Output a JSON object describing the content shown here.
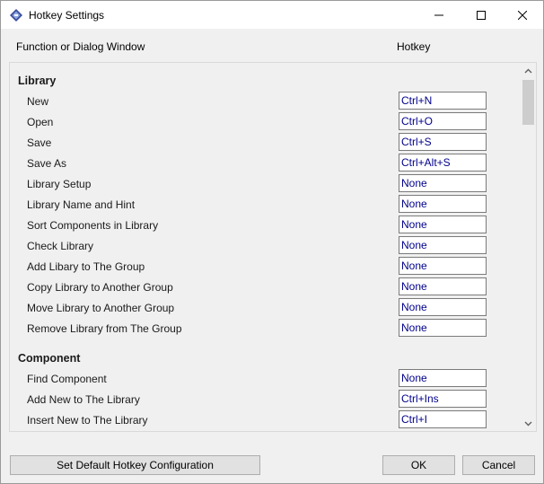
{
  "window": {
    "title": "Hotkey Settings",
    "app_icon": "app-diamond-icon",
    "minimize_icon": "minimize-icon",
    "maximize_icon": "maximize-icon",
    "close_icon": "close-icon"
  },
  "header": {
    "function_label": "Function or Dialog Window",
    "hotkey_label": "Hotkey"
  },
  "colors": {
    "hotkey_text": "#00008b",
    "window_bg": "#f0f0f0",
    "titlebar_bg": "#ffffff"
  },
  "groups": [
    {
      "title": "Library",
      "items": [
        {
          "label": "New",
          "hotkey": "Ctrl+N"
        },
        {
          "label": "Open",
          "hotkey": "Ctrl+O"
        },
        {
          "label": "Save",
          "hotkey": "Ctrl+S"
        },
        {
          "label": "Save As",
          "hotkey": "Ctrl+Alt+S"
        },
        {
          "label": "Library Setup",
          "hotkey": "None"
        },
        {
          "label": "Library Name and Hint",
          "hotkey": "None"
        },
        {
          "label": "Sort Components in Library",
          "hotkey": "None"
        },
        {
          "label": "Check Library",
          "hotkey": "None"
        },
        {
          "label": "Add Libary to The Group",
          "hotkey": "None"
        },
        {
          "label": "Copy Library to Another Group",
          "hotkey": "None"
        },
        {
          "label": "Move Library to Another Group",
          "hotkey": "None"
        },
        {
          "label": "Remove Library from The Group",
          "hotkey": "None"
        }
      ]
    },
    {
      "title": "Component",
      "items": [
        {
          "label": "Find Component",
          "hotkey": "None"
        },
        {
          "label": "Add New to The Library",
          "hotkey": "Ctrl+Ins"
        },
        {
          "label": "Insert New to The Library",
          "hotkey": "Ctrl+I"
        }
      ]
    }
  ],
  "buttons": {
    "default_config": "Set Default Hotkey Configuration",
    "ok": "OK",
    "cancel": "Cancel"
  },
  "scrollbar": {
    "up_icon": "scroll-up-arrow-icon",
    "down_icon": "scroll-down-arrow-icon"
  }
}
